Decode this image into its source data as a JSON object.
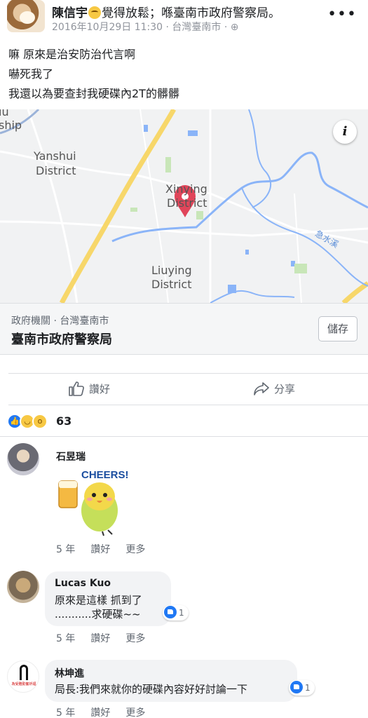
{
  "post": {
    "author": "陳信宇",
    "activity": "覺得放鬆；喺臺南市政府警察局。",
    "date": "2016年10月29日 11:30",
    "location": "台灣臺南市",
    "lines": [
      "嘛 原來是治安防治代言啊",
      "嚇死我了",
      "我還以為要查封我硬碟內2T的髒髒"
    ]
  },
  "map": {
    "labels": {
      "top_left_1": "iu",
      "top_left_2": "ship",
      "yanshui_1": "Yanshui",
      "yanshui_2": "District",
      "xinying_1": "Xinying",
      "xinying_2": "District",
      "liuying_1": "Liuying",
      "liuying_2": "District",
      "river": "急水溪"
    },
    "info": "i"
  },
  "place": {
    "category": "政府機關 · 台灣臺南市",
    "name": "臺南市政府警察局",
    "save_label": "儲存"
  },
  "actions": {
    "like": "讚好",
    "share": "分享"
  },
  "reactions": {
    "count": "63"
  },
  "comments": [
    {
      "name": "石昱瑞",
      "sticker_text": "CHEERS!",
      "time": "5 年",
      "like": "讚好",
      "more": "更多"
    },
    {
      "name": "Lucas Kuo",
      "line1": "原來是這樣 抓到了",
      "line2": "...........求硬碟~~",
      "likes": "1",
      "time": "5 年",
      "like": "讚好",
      "more": "更多"
    },
    {
      "name": "林坤進",
      "avatar_text": "為受難勤奮祈福",
      "line1": "局長:我們來就你的硬碟內容好好討論一下",
      "likes": "1",
      "time": "5 年",
      "like": "讚好",
      "more": "更多"
    }
  ],
  "colors": {
    "accent": "#2078f4",
    "pin": "#e0455a",
    "road": "#f7d76a",
    "water": "#8ab4f8"
  }
}
